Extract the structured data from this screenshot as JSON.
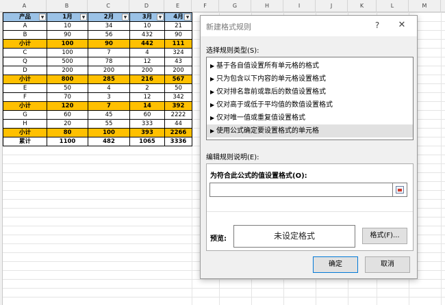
{
  "sheet": {
    "columns": [
      "A",
      "B",
      "C",
      "D",
      "E",
      "F",
      "G",
      "H",
      "I",
      "J",
      "K",
      "L",
      "M"
    ],
    "headers": [
      "产品",
      "1月",
      "2月",
      "3月",
      "4月"
    ],
    "filter_icon": "chevron-down-icon",
    "rows": [
      {
        "type": "data",
        "cells": [
          "A",
          "10",
          "34",
          "10",
          "21"
        ]
      },
      {
        "type": "data",
        "cells": [
          "B",
          "90",
          "56",
          "432",
          "90"
        ]
      },
      {
        "type": "sub",
        "cells": [
          "小计",
          "100",
          "90",
          "442",
          "111"
        ]
      },
      {
        "type": "data",
        "cells": [
          "C",
          "100",
          "7",
          "4",
          "324"
        ]
      },
      {
        "type": "data",
        "cells": [
          "Q",
          "500",
          "78",
          "12",
          "43"
        ]
      },
      {
        "type": "data",
        "cells": [
          "D",
          "200",
          "200",
          "200",
          "200"
        ]
      },
      {
        "type": "sub",
        "cells": [
          "小计",
          "800",
          "285",
          "216",
          "567"
        ]
      },
      {
        "type": "data",
        "cells": [
          "E",
          "50",
          "4",
          "2",
          "50"
        ]
      },
      {
        "type": "data",
        "cells": [
          "F",
          "70",
          "3",
          "12",
          "342"
        ]
      },
      {
        "type": "sub",
        "cells": [
          "小计",
          "120",
          "7",
          "14",
          "392"
        ]
      },
      {
        "type": "data",
        "cells": [
          "G",
          "60",
          "45",
          "60",
          "2222"
        ]
      },
      {
        "type": "data",
        "cells": [
          "H",
          "20",
          "55",
          "333",
          "44"
        ]
      },
      {
        "type": "sub",
        "cells": [
          "小计",
          "80",
          "100",
          "393",
          "2266"
        ]
      },
      {
        "type": "total",
        "cells": [
          "累计",
          "1100",
          "482",
          "1065",
          "3336"
        ]
      }
    ],
    "colors": {
      "header": "#9bc2e6",
      "subtotal": "#ffc000"
    }
  },
  "dialog": {
    "title": "新建格式规则",
    "help": "?",
    "close": "✕",
    "rule_type_label": "选择规则类型(S):",
    "rule_types": [
      "基于各自值设置所有单元格的格式",
      "只为包含以下内容的单元格设置格式",
      "仅对排名靠前或靠后的数值设置格式",
      "仅对高于或低于平均值的数值设置格式",
      "仅对唯一值或重复值设置格式",
      "使用公式确定要设置格式的单元格"
    ],
    "selected_index": 5,
    "arrow": "▶",
    "edit_desc_label": "编辑规则说明(E):",
    "formula_label": "为符合此公式的值设置格式(O):",
    "formula_value": "",
    "preview_label": "预览:",
    "preview_text": "未设定格式",
    "format_button": "格式(F)...",
    "ok_button": "确定",
    "cancel_button": "取消"
  }
}
